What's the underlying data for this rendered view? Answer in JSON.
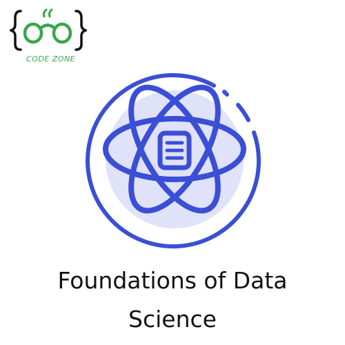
{
  "logo": {
    "icon": "glasses-braces-logo-icon",
    "text": "CODE ZONE",
    "color": "#3aa64a"
  },
  "emblem": {
    "icon": "atom-document-icon",
    "primary_color": "#3a4fd6",
    "background_color": "#dfe2f8"
  },
  "title": {
    "line1": "Foundations of Data",
    "line2": "Science"
  }
}
